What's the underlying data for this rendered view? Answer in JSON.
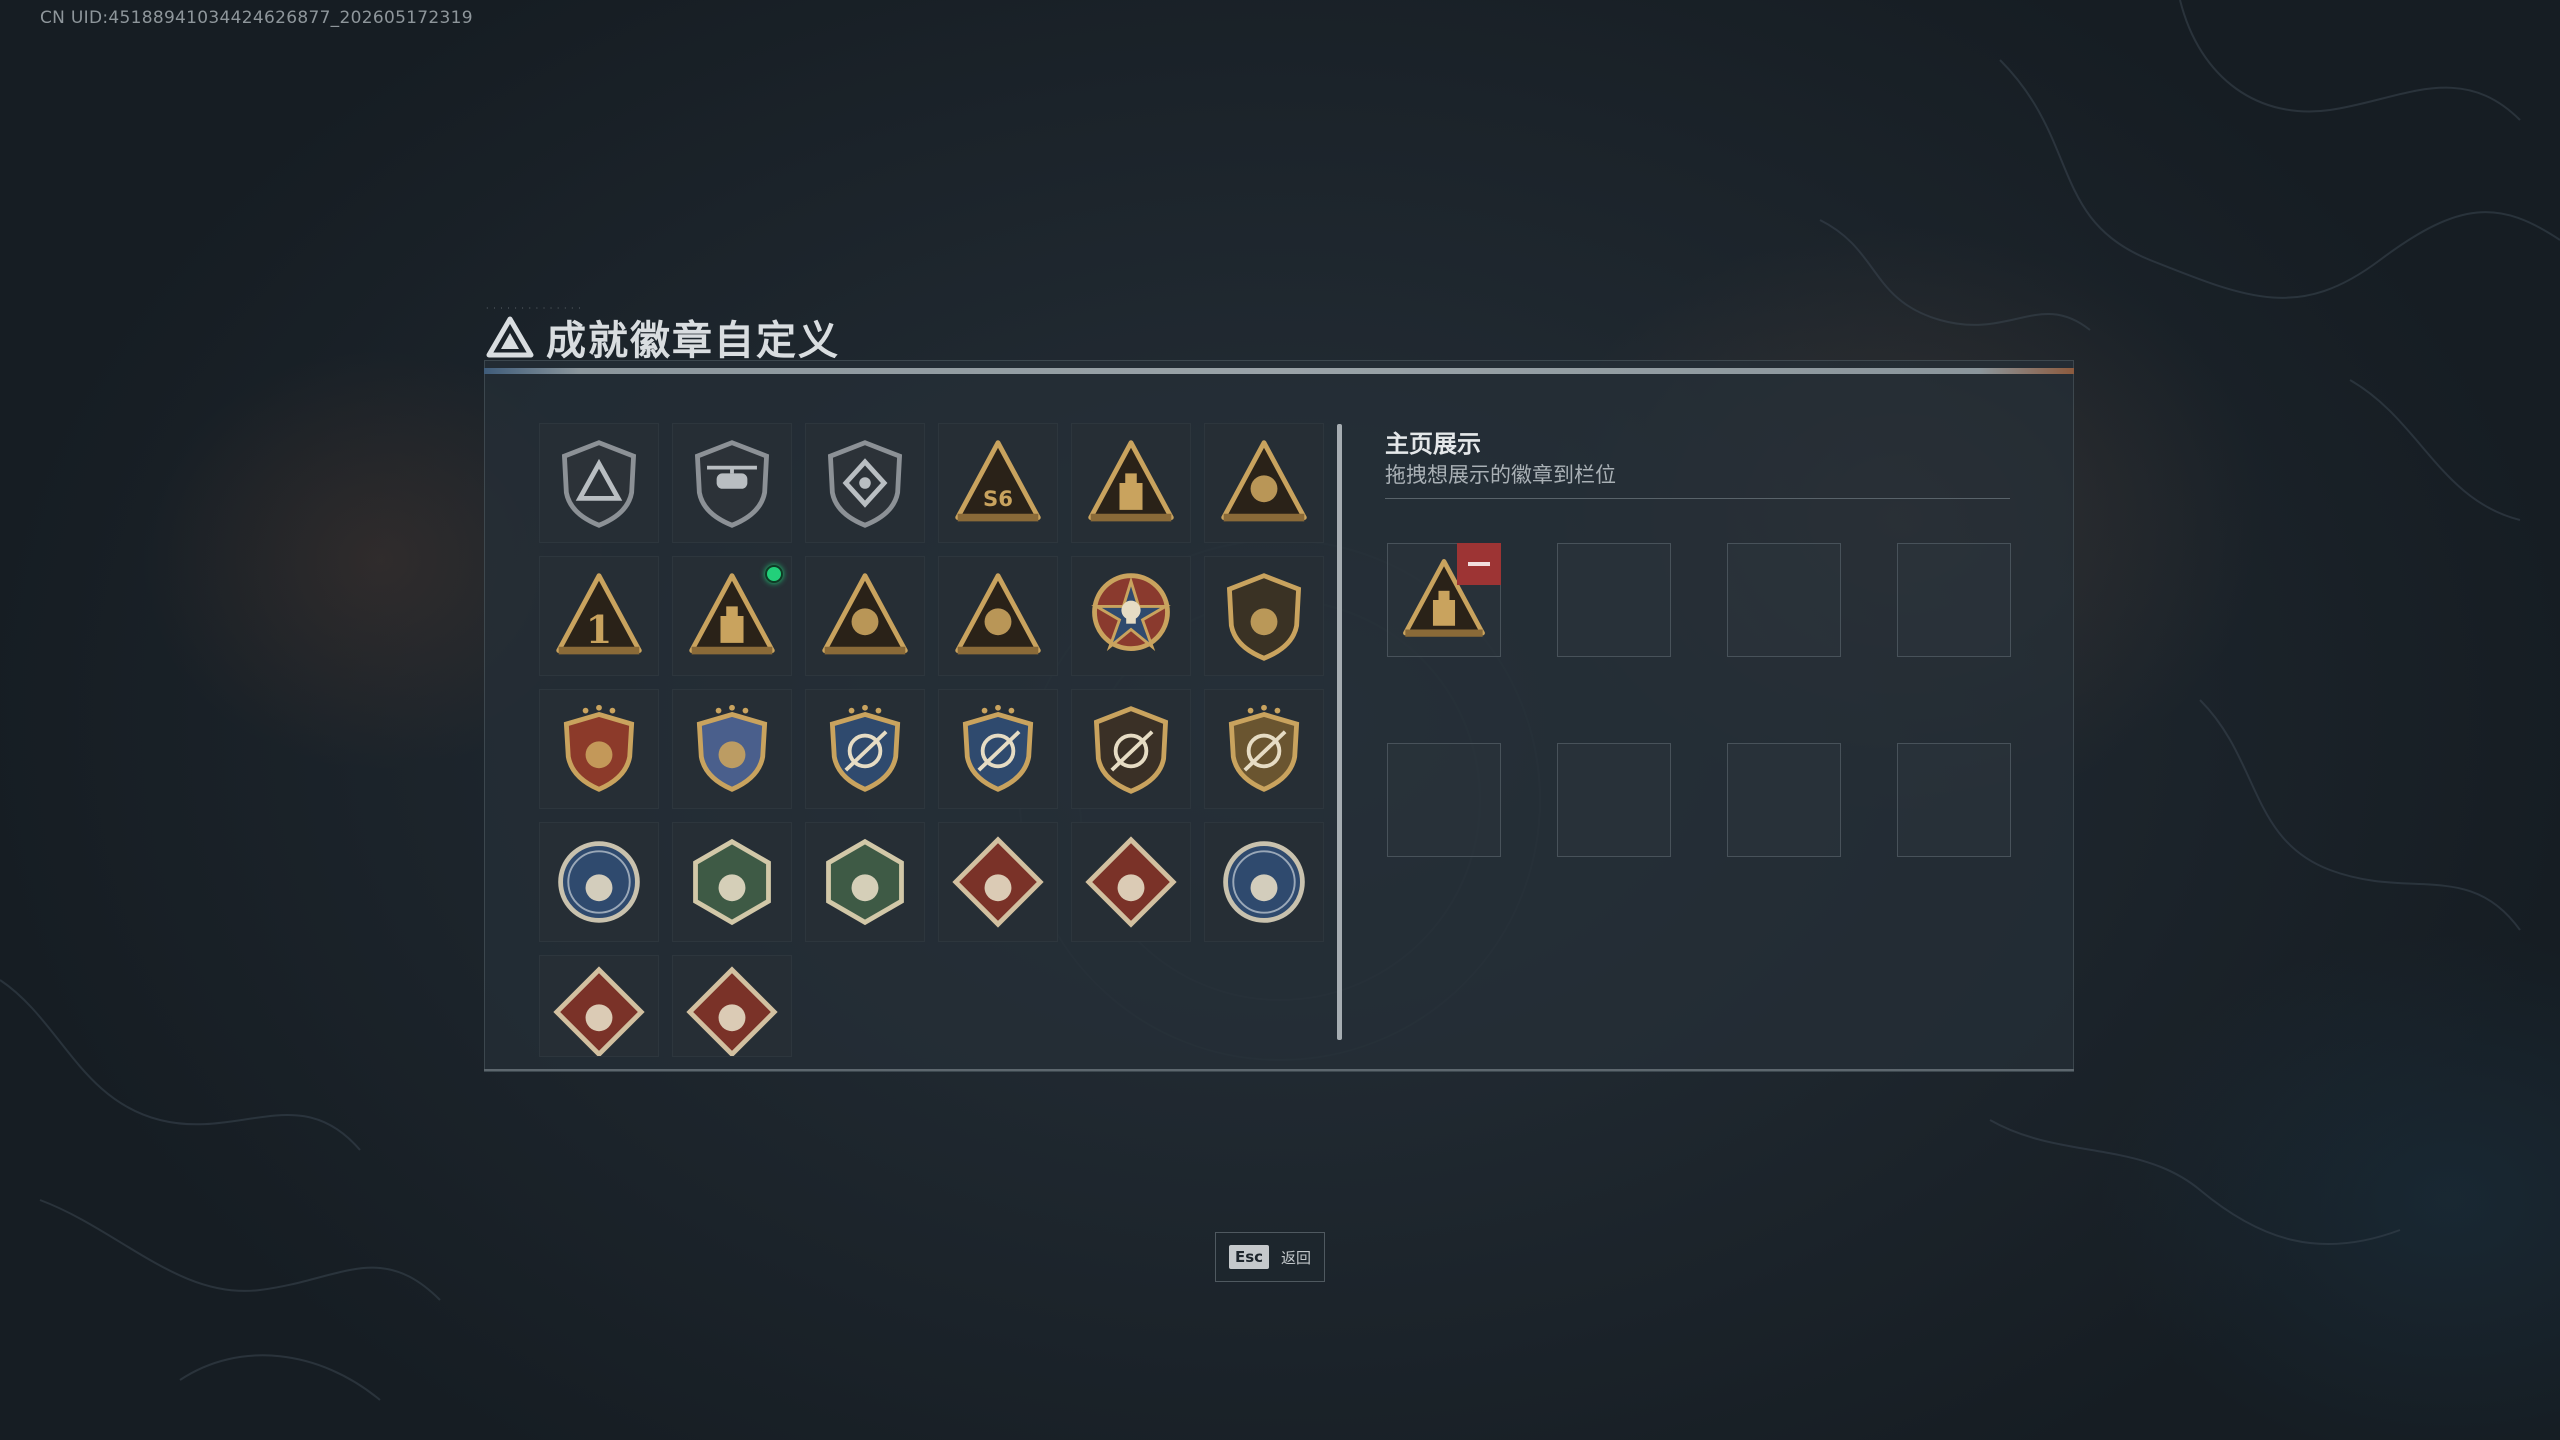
{
  "uid_text": "CN UID:451889410344246268​77_202605172319",
  "header": {
    "title": "成就徽章自定义",
    "logo_icon": "delta-logo-icon"
  },
  "colors": {
    "gold": "#c9a35e",
    "accent_red": "#9d3434",
    "new_dot": "#22d07a"
  },
  "badges": [
    {
      "name": "delta-shield-badge",
      "shape": "shield-dark",
      "glyph": "delta"
    },
    {
      "name": "helicopter-shield-badge",
      "shape": "shield-dark",
      "glyph": "heli"
    },
    {
      "name": "diamond-shield-badge",
      "shape": "shield-dark",
      "glyph": "diamond"
    },
    {
      "name": "s6-triangle-badge",
      "shape": "triangle",
      "glyph": "S6"
    },
    {
      "name": "tower-triangle-badge",
      "shape": "triangle",
      "glyph": "tower"
    },
    {
      "name": "wing-triangle-badge",
      "shape": "triangle",
      "glyph": "wing"
    },
    {
      "name": "number-one-triangle-badge",
      "shape": "triangle",
      "glyph": "1"
    },
    {
      "name": "crate-triangle-badge",
      "shape": "triangle",
      "glyph": "crate",
      "new": true
    },
    {
      "name": "hands-triangle-badge",
      "shape": "triangle",
      "glyph": "hands"
    },
    {
      "name": "soldiers-triangle-badge",
      "shape": "triangle",
      "glyph": "soldiers"
    },
    {
      "name": "skull-medal-badge",
      "shape": "medal-red",
      "glyph": "skull"
    },
    {
      "name": "fist-shield-badge",
      "shape": "shield-gold",
      "glyph": "fist"
    },
    {
      "name": "red-crest-badge",
      "shape": "crest-red",
      "glyph": "crest"
    },
    {
      "name": "blue-crest-badge",
      "shape": "crest-blue",
      "glyph": "crest"
    },
    {
      "name": "blue-crosshair-badge",
      "shape": "crest-navy",
      "glyph": "scope"
    },
    {
      "name": "blue-crosshair-star-badge",
      "shape": "crest-navy",
      "glyph": "scope"
    },
    {
      "name": "rifle-shield-badge",
      "shape": "shield-brown",
      "glyph": "rifle"
    },
    {
      "name": "gold-crosshair-badge",
      "shape": "crest-gold",
      "glyph": "scope"
    },
    {
      "name": "eagle-round-badge",
      "shape": "round-blue",
      "glyph": "eagle"
    },
    {
      "name": "hornet-hex-badge",
      "shape": "hex-green",
      "glyph": "bug"
    },
    {
      "name": "hornet-hex-badge-2",
      "shape": "hex-green",
      "glyph": "bug"
    },
    {
      "name": "dragon-diamond-badge",
      "shape": "diamond-red",
      "glyph": "dragon"
    },
    {
      "name": "runner-diamond-badge",
      "shape": "diamond-red",
      "glyph": "runner"
    },
    {
      "name": "wolf-round-badge",
      "shape": "round-blue",
      "glyph": "wolf"
    },
    {
      "name": "cobra-diamond-badge",
      "shape": "diamond-red",
      "glyph": "snake",
      "partial": true
    },
    {
      "name": "wheel-diamond-badge",
      "shape": "diamond-red",
      "glyph": "wheel",
      "partial": true
    }
  ],
  "side": {
    "title": "主页展示",
    "subtitle": "拖拽想展示的徽章到栏位",
    "slots": [
      {
        "filled": true,
        "badge": "crate-triangle-badge"
      },
      {
        "filled": false
      },
      {
        "filled": false
      },
      {
        "filled": false
      },
      {
        "filled": false
      },
      {
        "filled": false
      },
      {
        "filled": false
      },
      {
        "filled": false
      }
    ]
  },
  "footer": {
    "key": "Esc",
    "label": "返回"
  }
}
